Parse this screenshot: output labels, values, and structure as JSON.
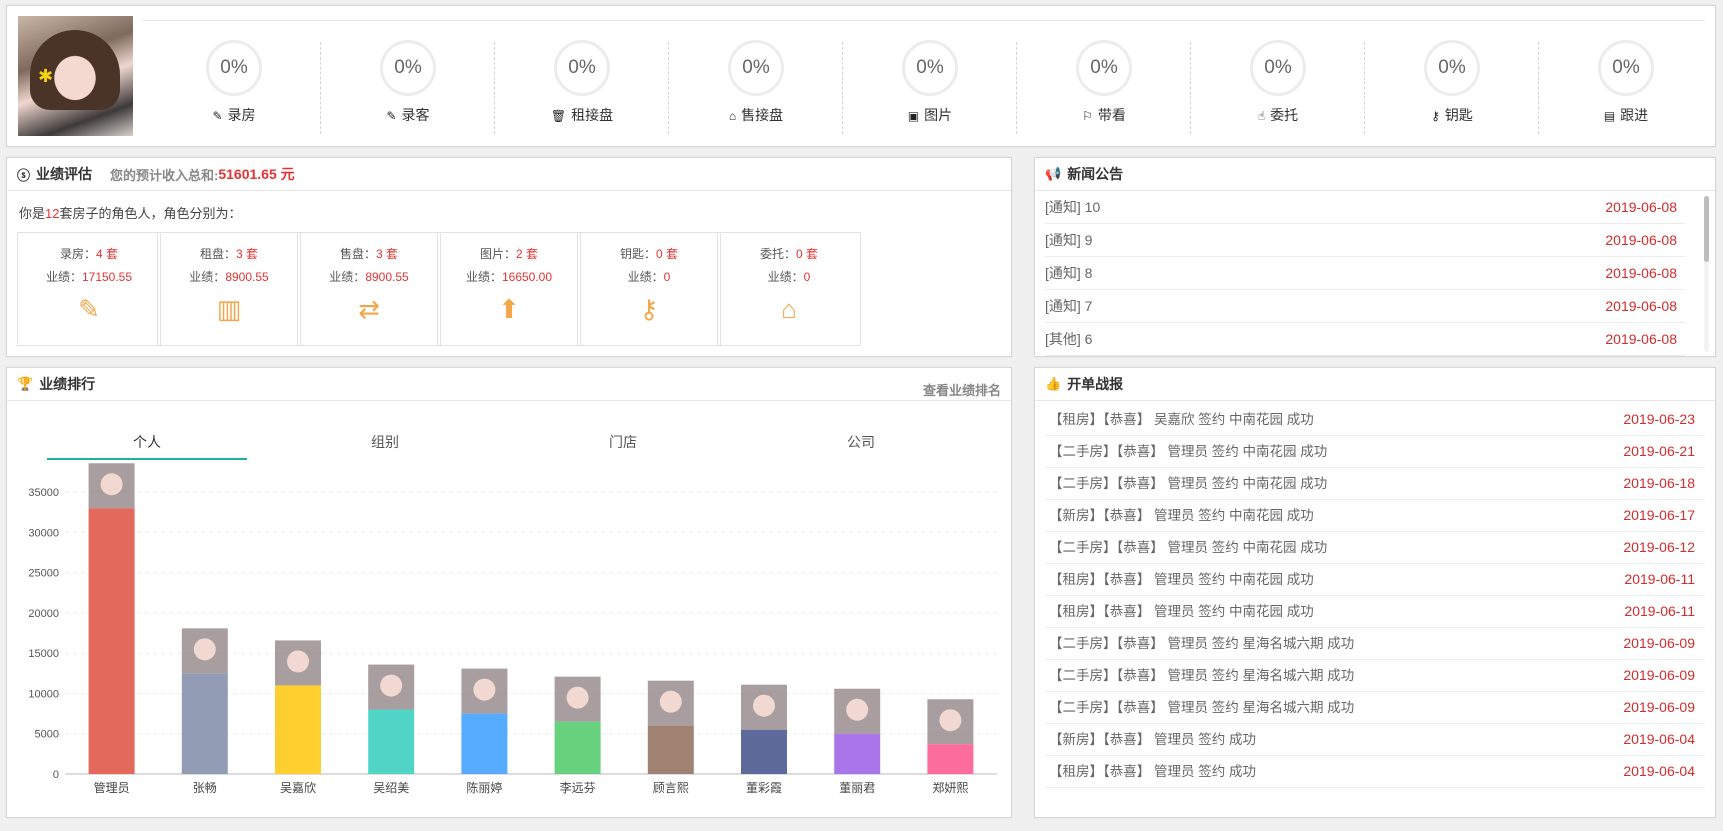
{
  "top_stats": [
    {
      "value": "0%",
      "label": "录房",
      "icon": "edit-icon"
    },
    {
      "value": "0%",
      "label": "录客",
      "icon": "edit-icon"
    },
    {
      "value": "0%",
      "label": "租接盘",
      "icon": "trash-icon"
    },
    {
      "value": "0%",
      "label": "售接盘",
      "icon": "home-icon"
    },
    {
      "value": "0%",
      "label": "图片",
      "icon": "image-icon"
    },
    {
      "value": "0%",
      "label": "带看",
      "icon": "flag-icon"
    },
    {
      "value": "0%",
      "label": "委托",
      "icon": "hand-icon"
    },
    {
      "value": "0%",
      "label": "钥匙",
      "icon": "key-icon"
    },
    {
      "value": "0%",
      "label": "跟进",
      "icon": "note-icon"
    }
  ],
  "performance": {
    "title": "业绩评估",
    "subtitle": "您的预计收入总和:",
    "total": "51601.65 元",
    "intro_prefix": "你是",
    "intro_count": "12",
    "intro_suffix": "套房子的角色人，角色分别为：",
    "cards": [
      {
        "name": "录房：",
        "count": "4 套",
        "perf_label": "业绩：",
        "perf": "17150.55",
        "icon": "edit-icon"
      },
      {
        "name": "租盘：",
        "count": "3 套",
        "perf_label": "业绩：",
        "perf": "8900.55",
        "icon": "suitcase-icon"
      },
      {
        "name": "售盘：",
        "count": "3 套",
        "perf_label": "业绩：",
        "perf": "8900.55",
        "icon": "user-exchange-icon"
      },
      {
        "name": "图片：",
        "count": "2 套",
        "perf_label": "业绩：",
        "perf": "16650.00",
        "icon": "image-upload-icon"
      },
      {
        "name": "钥匙：",
        "count": "0 套",
        "perf_label": "业绩：",
        "perf": "0",
        "icon": "key-icon"
      },
      {
        "name": "委托：",
        "count": "0 套",
        "perf_label": "业绩：",
        "perf": "0",
        "icon": "hand-home-icon"
      }
    ]
  },
  "news": {
    "title": "新闻公告",
    "items": [
      {
        "text": "[通知] 10",
        "date": "2019-06-08"
      },
      {
        "text": "[通知] 9",
        "date": "2019-06-08"
      },
      {
        "text": "[通知] 8",
        "date": "2019-06-08"
      },
      {
        "text": "[通知] 7",
        "date": "2019-06-08"
      },
      {
        "text": "[其他] 6",
        "date": "2019-06-08"
      }
    ]
  },
  "ranking": {
    "title": "业绩排行",
    "link": "查看业绩排名",
    "tabs": [
      "个人",
      "组别",
      "门店",
      "公司"
    ],
    "active_tab": 0
  },
  "chart_data": {
    "type": "bar",
    "categories": [
      "管理员",
      "张畅",
      "吴嘉欣",
      "吴绍美",
      "陈丽婷",
      "李远芬",
      "顾言熙",
      "董彩霞",
      "董丽君",
      "郑妍熙"
    ],
    "values": [
      33000,
      12500,
      11000,
      8000,
      7500,
      6500,
      6000,
      5500,
      5000,
      3700
    ],
    "colors": [
      "#e2695b",
      "#929db5",
      "#fecf2f",
      "#50d4c6",
      "#56abfe",
      "#67d17e",
      "#a08273",
      "#5e6a9a",
      "#aa75e9",
      "#fc6c9d"
    ],
    "ylim": [
      0,
      38000
    ],
    "yticks": [
      0,
      5000,
      10000,
      15000,
      20000,
      25000,
      30000,
      35000
    ],
    "grid": true
  },
  "deals": {
    "title": "开单战报",
    "items": [
      {
        "text": "【租房】【恭喜】 吴嘉欣 签约 中南花园 成功",
        "date": "2019-06-23"
      },
      {
        "text": "【二手房】【恭喜】 管理员 签约 中南花园 成功",
        "date": "2019-06-21"
      },
      {
        "text": "【二手房】【恭喜】 管理员 签约 中南花园 成功",
        "date": "2019-06-18"
      },
      {
        "text": "【新房】【恭喜】 管理员 签约 中南花园 成功",
        "date": "2019-06-17"
      },
      {
        "text": "【二手房】【恭喜】 管理员 签约 中南花园 成功",
        "date": "2019-06-12"
      },
      {
        "text": "【租房】【恭喜】 管理员 签约 中南花园 成功",
        "date": "2019-06-11"
      },
      {
        "text": "【租房】【恭喜】 管理员 签约 中南花园 成功",
        "date": "2019-06-11"
      },
      {
        "text": "【二手房】【恭喜】 管理员 签约 星海名城六期 成功",
        "date": "2019-06-09"
      },
      {
        "text": "【二手房】【恭喜】 管理员 签约 星海名城六期 成功",
        "date": "2019-06-09"
      },
      {
        "text": "【二手房】【恭喜】 管理员 签约 星海名城六期 成功",
        "date": "2019-06-09"
      },
      {
        "text": "【新房】【恭喜】 管理员 签约 成功",
        "date": "2019-06-04"
      },
      {
        "text": "【租房】【恭喜】 管理员 签约 成功",
        "date": "2019-06-04"
      }
    ]
  }
}
